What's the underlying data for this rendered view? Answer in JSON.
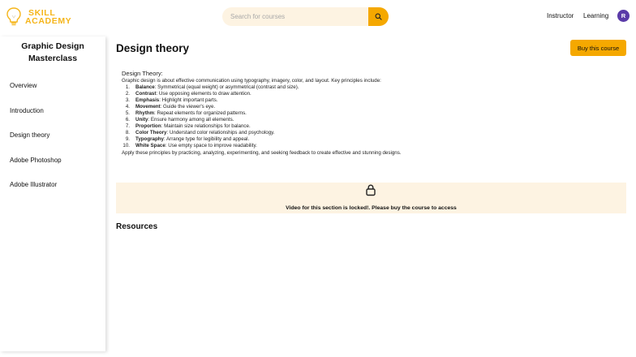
{
  "brand": {
    "line1": "SKILL",
    "line2": "ACADEMY",
    "accent": "#f5a800"
  },
  "search": {
    "placeholder": "Search for courses"
  },
  "nav": {
    "instructor": "Instructor",
    "learning": "Learning",
    "avatar_initial": "R"
  },
  "sidebar": {
    "course_title_line1": "Graphic Design",
    "course_title_line2": "Masterclass",
    "items": [
      {
        "label": "Overview"
      },
      {
        "label": "Introduction"
      },
      {
        "label": "Design theory"
      },
      {
        "label": "Adobe Photoshop"
      },
      {
        "label": "Adobe Illustrator"
      }
    ]
  },
  "main": {
    "title": "Design theory",
    "buy_label": "Buy this course",
    "content": {
      "heading": "Design Theory:",
      "intro": "Graphic design is about effective communication using typography, imagery, color, and layout. Key principles include:",
      "principles": [
        {
          "num": "1.",
          "term": "Balance",
          "desc": ": Symmetrical (equal weight) or asymmetrical (contrast and size)."
        },
        {
          "num": "2.",
          "term": "Contrast",
          "desc": ": Use opposing elements to draw attention."
        },
        {
          "num": "3.",
          "term": "Emphasis",
          "desc": ": Highlight important parts."
        },
        {
          "num": "4.",
          "term": "Movement",
          "desc": ": Guide the viewer's eye."
        },
        {
          "num": "5.",
          "term": "Rhythm",
          "desc": ": Repeat elements for organized patterns."
        },
        {
          "num": "6.",
          "term": "Unity",
          "desc": ": Ensure harmony among all elements."
        },
        {
          "num": "7.",
          "term": "Proportion",
          "desc": ": Maintain size relationships for balance."
        },
        {
          "num": "8.",
          "term": "Color Theory",
          "desc": ": Understand color relationships and psychology."
        },
        {
          "num": "9.",
          "term": "Typography",
          "desc": ": Arrange type for legibility and appeal."
        },
        {
          "num": "10.",
          "term": "White Space",
          "desc": ": Use empty space to improve readability."
        }
      ],
      "outro": "Apply these principles by practicing, analyzing, experimenting, and seeking feedback to create effective and stunning designs."
    },
    "locked_message": "Video for this section is locked!. Please buy the course to access",
    "resources_title": "Resources"
  }
}
